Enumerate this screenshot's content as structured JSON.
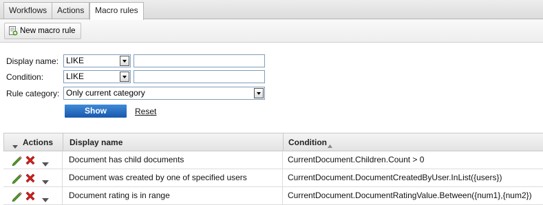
{
  "tabs": [
    {
      "label": "Workflows",
      "active": false
    },
    {
      "label": "Actions",
      "active": false
    },
    {
      "label": "Macro rules",
      "active": true
    }
  ],
  "toolbar": {
    "new_button_label": "New macro rule",
    "icon": "new-document-icon"
  },
  "filter": {
    "display_name_label": "Display name:",
    "display_name_operator": "LIKE",
    "display_name_value": "",
    "condition_label": "Condition:",
    "condition_operator": "LIKE",
    "condition_value": "",
    "category_label": "Rule category:",
    "category_value": "Only current category",
    "show_label": "Show",
    "reset_label": "Reset"
  },
  "grid": {
    "columns": {
      "actions": "Actions",
      "display_name": "Display name",
      "condition": "Condition"
    },
    "sort": {
      "column": "condition",
      "direction": "asc"
    },
    "row_actions": [
      "edit-icon",
      "delete-icon",
      "more-actions-icon"
    ],
    "rows": [
      {
        "display_name": "Document has child documents",
        "condition": "CurrentDocument.Children.Count > 0"
      },
      {
        "display_name": "Document was created by one of specified users",
        "condition": "CurrentDocument.DocumentCreatedByUser.InList({users})"
      },
      {
        "display_name": "Document rating is in range",
        "condition": "CurrentDocument.DocumentRatingValue.Between({num1},{num2})"
      }
    ]
  },
  "colors": {
    "accent": "#2b6fc4",
    "delete": "#d32020",
    "edit": "#5a9a2a"
  }
}
